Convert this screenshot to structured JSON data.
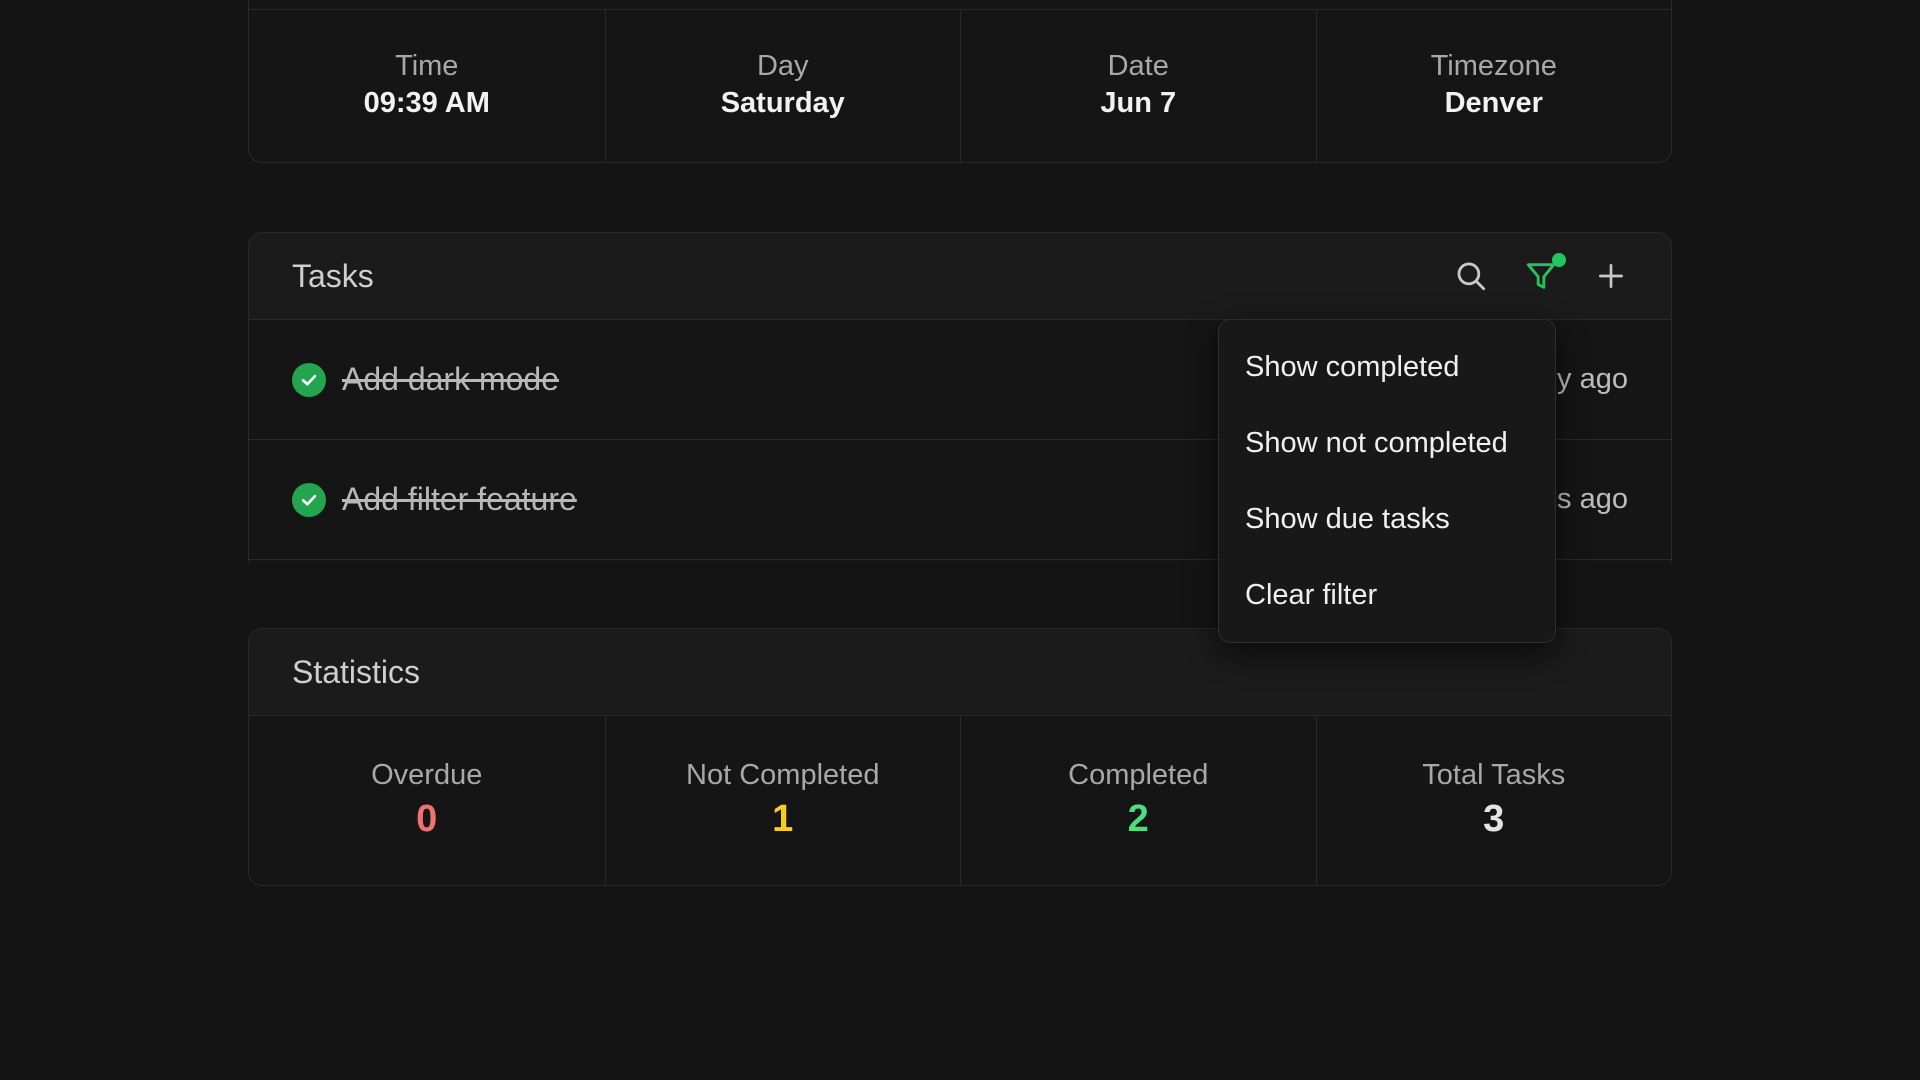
{
  "info": {
    "cells": [
      {
        "label": "Time",
        "value": "09:39 AM"
      },
      {
        "label": "Day",
        "value": "Saturday"
      },
      {
        "label": "Date",
        "value": "Jun 7"
      },
      {
        "label": "Timezone",
        "value": "Denver"
      }
    ]
  },
  "tasks": {
    "title": "Tasks",
    "icons": {
      "search": "search-icon",
      "filter": "filter-icon",
      "add": "plus-icon"
    },
    "filter_active_color": "#22c55e",
    "items": [
      {
        "title": "Add dark mode",
        "completed": true,
        "time": "y ago"
      },
      {
        "title": "Add filter feature",
        "completed": true,
        "time": "s ago"
      }
    ]
  },
  "filter_menu": {
    "items": [
      "Show completed",
      "Show not completed",
      "Show due tasks",
      "Clear filter"
    ]
  },
  "statistics": {
    "title": "Statistics",
    "cells": [
      {
        "label": "Overdue",
        "value": "0",
        "color": "#f07171"
      },
      {
        "label": "Not Completed",
        "value": "1",
        "color": "#facc15"
      },
      {
        "label": "Completed",
        "value": "2",
        "color": "#4ade80"
      },
      {
        "label": "Total Tasks",
        "value": "3",
        "color": "#e5e5e5"
      }
    ]
  }
}
